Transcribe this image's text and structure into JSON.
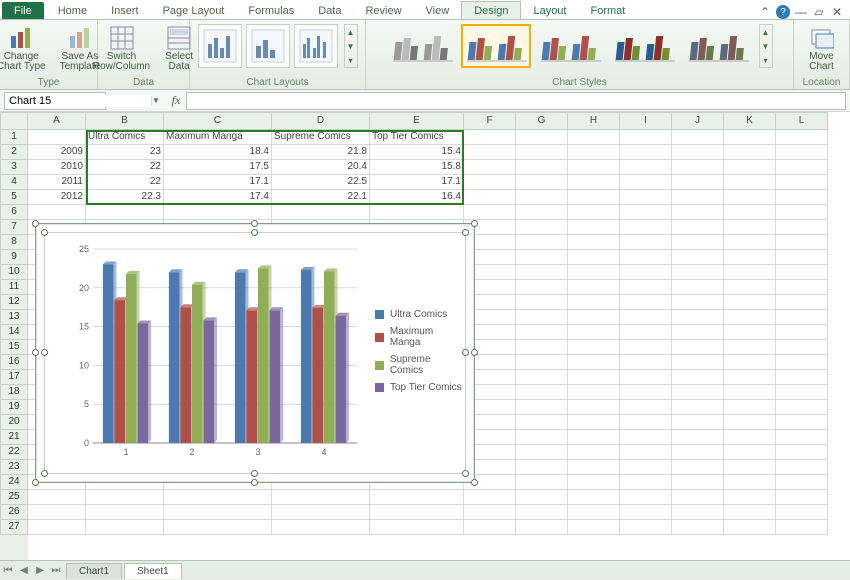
{
  "tabs": {
    "file": "File",
    "home": "Home",
    "insert": "Insert",
    "page": "Page Layout",
    "formulas": "Formulas",
    "data": "Data",
    "review": "Review",
    "view": "View",
    "design": "Design",
    "layout": "Layout",
    "format": "Format"
  },
  "ribbon": {
    "type": {
      "label": "Type",
      "change": "Change\nChart Type",
      "saveas": "Save As\nTemplate"
    },
    "data": {
      "label": "Data",
      "switch": "Switch\nRow/Column",
      "select": "Select\nData"
    },
    "layouts": {
      "label": "Chart Layouts"
    },
    "styles": {
      "label": "Chart Styles"
    },
    "location": {
      "label": "Location",
      "move": "Move\nChart"
    }
  },
  "namebox": "Chart 15",
  "fx_label": "fx",
  "columns": [
    "A",
    "B",
    "C",
    "D",
    "E",
    "F",
    "G",
    "H",
    "I",
    "J",
    "K",
    "L"
  ],
  "rows": [
    "1",
    "2",
    "3",
    "4",
    "5",
    "6",
    "7",
    "8",
    "9",
    "10",
    "11",
    "12",
    "13",
    "14",
    "15",
    "16",
    "17",
    "18",
    "19",
    "20",
    "21",
    "22",
    "23",
    "24",
    "25",
    "26",
    "27"
  ],
  "table": {
    "headers": {
      "B": "Ultra Comics",
      "C": "Maximum Manga",
      "D": "Supreme Comics",
      "E": "Top Tier Comics"
    },
    "rows": [
      {
        "A": "2009",
        "B": "23",
        "C": "18.4",
        "D": "21.8",
        "E": "15.4"
      },
      {
        "A": "2010",
        "B": "22",
        "C": "17.5",
        "D": "20.4",
        "E": "15.8"
      },
      {
        "A": "2011",
        "B": "22",
        "C": "17.1",
        "D": "22.5",
        "E": "17.1"
      },
      {
        "A": "2012",
        "B": "22.3",
        "C": "17.4",
        "D": "22.1",
        "E": "16.4"
      }
    ]
  },
  "chart_data": {
    "type": "bar",
    "categories": [
      "1",
      "2",
      "3",
      "4"
    ],
    "series": [
      {
        "name": "Ultra Comics",
        "values": [
          23,
          22,
          22,
          22.3
        ],
        "color": "#4a7ab0"
      },
      {
        "name": "Maximum Manga",
        "values": [
          18.4,
          17.5,
          17.1,
          17.4
        ],
        "color": "#b05048"
      },
      {
        "name": "Supreme Comics",
        "values": [
          21.8,
          20.4,
          22.5,
          22.1
        ],
        "color": "#8fae56"
      },
      {
        "name": "Top Tier Comics",
        "values": [
          15.4,
          15.8,
          17.1,
          16.4
        ],
        "color": "#7a679e"
      }
    ],
    "ylim": [
      0,
      25
    ],
    "yticks": [
      0,
      5,
      10,
      15,
      20,
      25
    ],
    "xlabel": "",
    "ylabel": "",
    "title": ""
  },
  "sheets": {
    "chart": "Chart1",
    "sheet": "Sheet1"
  }
}
